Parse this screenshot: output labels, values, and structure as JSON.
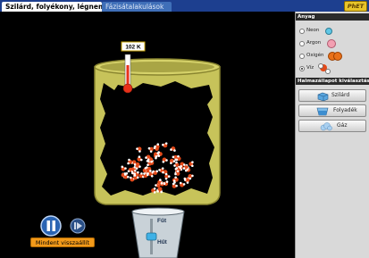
{
  "tabs": [
    {
      "label": "Szilárd, folyékony, légnemű",
      "active": true
    },
    {
      "label": "Fázisátalakulások",
      "active": false
    }
  ],
  "logo": {
    "text": "PhET"
  },
  "thermometer": {
    "reading": "102 K"
  },
  "stove": {
    "heat_label": "Fűt",
    "cool_label": "Hűt",
    "slider_level": 0.5
  },
  "playback": {
    "pause_icon": "pause-icon",
    "step_icon": "step-forward-icon"
  },
  "reset_button": {
    "label": "Mindent visszaállít"
  },
  "panel": {
    "substance_title": "Anyag",
    "substances": [
      {
        "label": "Neon",
        "selected": false,
        "color": "#5fc7e6"
      },
      {
        "label": "Argon",
        "selected": false,
        "color": "#f3a0b2"
      },
      {
        "label": "Oxigén",
        "selected": false,
        "color": "#e9711a"
      },
      {
        "label": "Víz",
        "selected": true,
        "color": "#e34a1a"
      }
    ],
    "phase_title": "Halmazállapot kiválasztása",
    "phase_buttons": [
      {
        "label": "Szilárd",
        "icon": "ice-cube-icon"
      },
      {
        "label": "Folyadék",
        "icon": "liquid-cup-icon"
      },
      {
        "label": "Gáz",
        "icon": "gas-cloud-icon"
      }
    ]
  },
  "colors": {
    "tab_bar": "#1d3f8f",
    "container": "#c7c35a",
    "water_oxygen": "#e34a1a",
    "water_hydrogen": "#ffffff",
    "reset_button": "#f39a1a"
  }
}
